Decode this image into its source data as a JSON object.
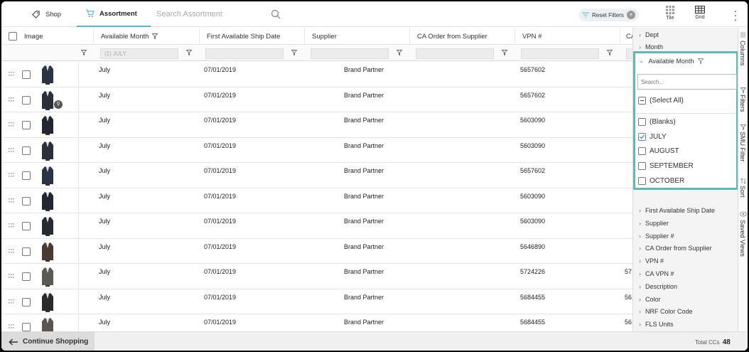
{
  "tabs": [
    {
      "label": "Shop",
      "icon": "tag-icon"
    },
    {
      "label": "Assortment",
      "icon": "cart-icon",
      "active": true
    }
  ],
  "search": {
    "placeholder": "Search Assortment"
  },
  "reset_filters": "Reset Filters",
  "views": [
    {
      "label": "Tile"
    },
    {
      "label": "Grid"
    }
  ],
  "grid": {
    "columns": [
      "Image",
      "Available Month",
      "First Available Ship Date",
      "Supplier",
      "CA Order from Supplier",
      "VPN #",
      "CA"
    ],
    "filter_value": "(1) JULY",
    "rows": [
      {
        "month": "July",
        "ship": "07/01/2019",
        "supplier": "Brand Partner",
        "vpn": "5657602",
        "ca": ""
      },
      {
        "month": "July",
        "ship": "07/01/2019",
        "supplier": "Brand Partner",
        "vpn": "5657602",
        "ca": ""
      },
      {
        "month": "July",
        "ship": "07/01/2019",
        "supplier": "Brand Partner",
        "vpn": "5603090",
        "ca": ""
      },
      {
        "month": "July",
        "ship": "07/01/2019",
        "supplier": "Brand Partner",
        "vpn": "5603090",
        "ca": ""
      },
      {
        "month": "July",
        "ship": "07/01/2019",
        "supplier": "Brand Partner",
        "vpn": "5657602",
        "ca": ""
      },
      {
        "month": "July",
        "ship": "07/01/2019",
        "supplier": "Brand Partner",
        "vpn": "5603090",
        "ca": ""
      },
      {
        "month": "July",
        "ship": "07/01/2019",
        "supplier": "Brand Partner",
        "vpn": "5603090",
        "ca": ""
      },
      {
        "month": "July",
        "ship": "07/01/2019",
        "supplier": "Brand Partner",
        "vpn": "5646890",
        "ca": ""
      },
      {
        "month": "July",
        "ship": "07/01/2019",
        "supplier": "Brand Partner",
        "vpn": "5724226",
        "ca": "57"
      },
      {
        "month": "July",
        "ship": "07/01/2019",
        "supplier": "Brand Partner",
        "vpn": "5684455",
        "ca": "56"
      },
      {
        "month": "July",
        "ship": "07/01/2019",
        "supplier": "Brand Partner",
        "vpn": "5684455",
        "ca": "56"
      }
    ],
    "badge_text": "⚲"
  },
  "side_panel": {
    "top_items": [
      "Dept",
      "Month"
    ],
    "expanded": {
      "title": "Available Month",
      "search_placeholder": "Search...",
      "select_all": "(Select All)",
      "options": [
        {
          "label": "(Blanks)",
          "checked": false
        },
        {
          "label": "JULY",
          "checked": true
        },
        {
          "label": "AUGUST",
          "checked": false
        },
        {
          "label": "SEPTEMBER",
          "checked": false
        },
        {
          "label": "OCTOBER",
          "checked": false
        }
      ]
    },
    "bottom_items": [
      "First Available Ship Date",
      "Supplier",
      "Supplier #",
      "CA Order from Supplier",
      "VPN #",
      "CA VPN #",
      "Description",
      "Color",
      "NRF Color Code",
      "FLS Units"
    ]
  },
  "rail": [
    "Columns",
    "Filters",
    "SMU Filter",
    "Sort",
    "Saved Views"
  ],
  "footer": {
    "continue_label": "Continue Shopping",
    "total_label": "Total CCs",
    "total_value": "48"
  },
  "colors": {
    "accent": "#5bb8c5",
    "highlight": "#5fbab5"
  }
}
